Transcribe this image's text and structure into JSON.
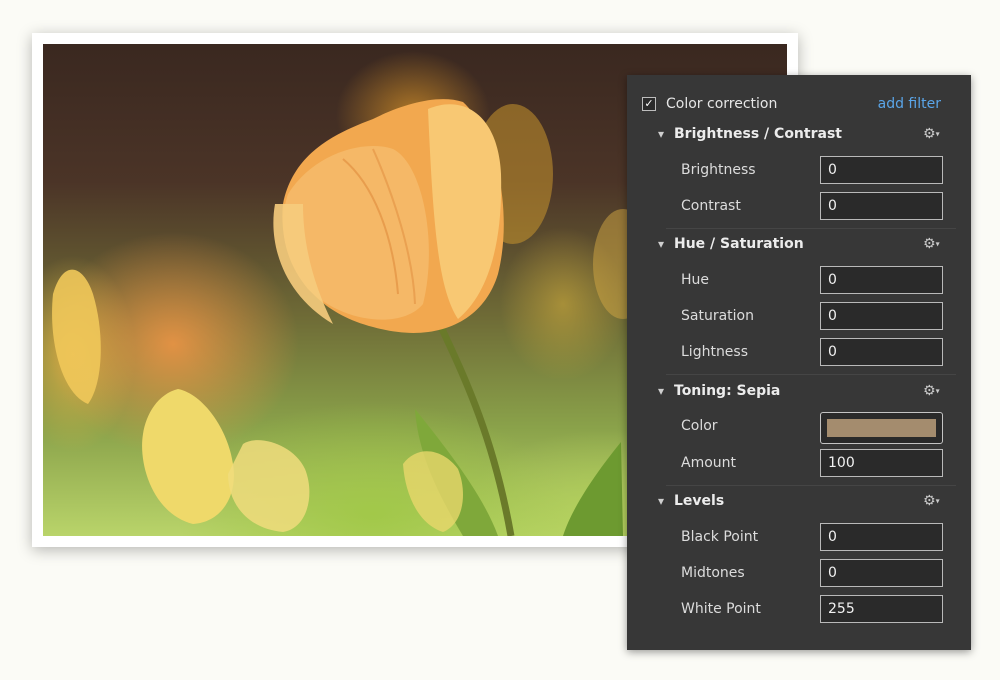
{
  "panel": {
    "title": "Color correction",
    "enabled": true,
    "add_filter_label": "add filter",
    "background": "#373737",
    "accent": "#5aa5e8"
  },
  "sections": {
    "brightness_contrast": {
      "title": "Brightness / Contrast",
      "rows": {
        "brightness": {
          "label": "Brightness",
          "value": "0"
        },
        "contrast": {
          "label": "Contrast",
          "value": "0"
        }
      }
    },
    "hue_saturation": {
      "title": "Hue / Saturation",
      "rows": {
        "hue": {
          "label": "Hue",
          "value": "0"
        },
        "saturation": {
          "label": "Saturation",
          "value": "0"
        },
        "lightness": {
          "label": "Lightness",
          "value": "0"
        }
      }
    },
    "toning_sepia": {
      "title": "Toning: Sepia",
      "rows": {
        "color": {
          "label": "Color",
          "swatch": "#a48c6e"
        },
        "amount": {
          "label": "Amount",
          "value": "100"
        }
      }
    },
    "levels": {
      "title": "Levels",
      "rows": {
        "black_point": {
          "label": "Black Point",
          "value": "0"
        },
        "midtones": {
          "label": "Midtones",
          "value": "0"
        },
        "white_point": {
          "label": "White Point",
          "value": "255"
        }
      }
    }
  },
  "icons": {
    "checkbox_mark": "✓",
    "chevron": "▾",
    "gear": "⚙",
    "gear_caret": "▾"
  },
  "photo": {
    "subject": "tulip-photo"
  }
}
